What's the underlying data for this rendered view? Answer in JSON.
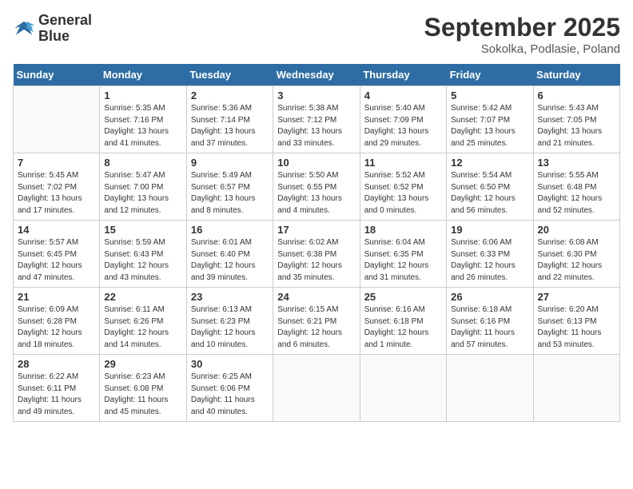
{
  "logo": {
    "line1": "General",
    "line2": "Blue"
  },
  "title": "September 2025",
  "location": "Sokolka, Podlasie, Poland",
  "days_of_week": [
    "Sunday",
    "Monday",
    "Tuesday",
    "Wednesday",
    "Thursday",
    "Friday",
    "Saturday"
  ],
  "weeks": [
    [
      {
        "day": "",
        "info": ""
      },
      {
        "day": "1",
        "info": "Sunrise: 5:35 AM\nSunset: 7:16 PM\nDaylight: 13 hours\nand 41 minutes."
      },
      {
        "day": "2",
        "info": "Sunrise: 5:36 AM\nSunset: 7:14 PM\nDaylight: 13 hours\nand 37 minutes."
      },
      {
        "day": "3",
        "info": "Sunrise: 5:38 AM\nSunset: 7:12 PM\nDaylight: 13 hours\nand 33 minutes."
      },
      {
        "day": "4",
        "info": "Sunrise: 5:40 AM\nSunset: 7:09 PM\nDaylight: 13 hours\nand 29 minutes."
      },
      {
        "day": "5",
        "info": "Sunrise: 5:42 AM\nSunset: 7:07 PM\nDaylight: 13 hours\nand 25 minutes."
      },
      {
        "day": "6",
        "info": "Sunrise: 5:43 AM\nSunset: 7:05 PM\nDaylight: 13 hours\nand 21 minutes."
      }
    ],
    [
      {
        "day": "7",
        "info": "Sunrise: 5:45 AM\nSunset: 7:02 PM\nDaylight: 13 hours\nand 17 minutes."
      },
      {
        "day": "8",
        "info": "Sunrise: 5:47 AM\nSunset: 7:00 PM\nDaylight: 13 hours\nand 12 minutes."
      },
      {
        "day": "9",
        "info": "Sunrise: 5:49 AM\nSunset: 6:57 PM\nDaylight: 13 hours\nand 8 minutes."
      },
      {
        "day": "10",
        "info": "Sunrise: 5:50 AM\nSunset: 6:55 PM\nDaylight: 13 hours\nand 4 minutes."
      },
      {
        "day": "11",
        "info": "Sunrise: 5:52 AM\nSunset: 6:52 PM\nDaylight: 13 hours\nand 0 minutes."
      },
      {
        "day": "12",
        "info": "Sunrise: 5:54 AM\nSunset: 6:50 PM\nDaylight: 12 hours\nand 56 minutes."
      },
      {
        "day": "13",
        "info": "Sunrise: 5:55 AM\nSunset: 6:48 PM\nDaylight: 12 hours\nand 52 minutes."
      }
    ],
    [
      {
        "day": "14",
        "info": "Sunrise: 5:57 AM\nSunset: 6:45 PM\nDaylight: 12 hours\nand 47 minutes."
      },
      {
        "day": "15",
        "info": "Sunrise: 5:59 AM\nSunset: 6:43 PM\nDaylight: 12 hours\nand 43 minutes."
      },
      {
        "day": "16",
        "info": "Sunrise: 6:01 AM\nSunset: 6:40 PM\nDaylight: 12 hours\nand 39 minutes."
      },
      {
        "day": "17",
        "info": "Sunrise: 6:02 AM\nSunset: 6:38 PM\nDaylight: 12 hours\nand 35 minutes."
      },
      {
        "day": "18",
        "info": "Sunrise: 6:04 AM\nSunset: 6:35 PM\nDaylight: 12 hours\nand 31 minutes."
      },
      {
        "day": "19",
        "info": "Sunrise: 6:06 AM\nSunset: 6:33 PM\nDaylight: 12 hours\nand 26 minutes."
      },
      {
        "day": "20",
        "info": "Sunrise: 6:08 AM\nSunset: 6:30 PM\nDaylight: 12 hours\nand 22 minutes."
      }
    ],
    [
      {
        "day": "21",
        "info": "Sunrise: 6:09 AM\nSunset: 6:28 PM\nDaylight: 12 hours\nand 18 minutes."
      },
      {
        "day": "22",
        "info": "Sunrise: 6:11 AM\nSunset: 6:26 PM\nDaylight: 12 hours\nand 14 minutes."
      },
      {
        "day": "23",
        "info": "Sunrise: 6:13 AM\nSunset: 6:23 PM\nDaylight: 12 hours\nand 10 minutes."
      },
      {
        "day": "24",
        "info": "Sunrise: 6:15 AM\nSunset: 6:21 PM\nDaylight: 12 hours\nand 6 minutes."
      },
      {
        "day": "25",
        "info": "Sunrise: 6:16 AM\nSunset: 6:18 PM\nDaylight: 12 hours\nand 1 minute."
      },
      {
        "day": "26",
        "info": "Sunrise: 6:18 AM\nSunset: 6:16 PM\nDaylight: 11 hours\nand 57 minutes."
      },
      {
        "day": "27",
        "info": "Sunrise: 6:20 AM\nSunset: 6:13 PM\nDaylight: 11 hours\nand 53 minutes."
      }
    ],
    [
      {
        "day": "28",
        "info": "Sunrise: 6:22 AM\nSunset: 6:11 PM\nDaylight: 11 hours\nand 49 minutes."
      },
      {
        "day": "29",
        "info": "Sunrise: 6:23 AM\nSunset: 6:08 PM\nDaylight: 11 hours\nand 45 minutes."
      },
      {
        "day": "30",
        "info": "Sunrise: 6:25 AM\nSunset: 6:06 PM\nDaylight: 11 hours\nand 40 minutes."
      },
      {
        "day": "",
        "info": ""
      },
      {
        "day": "",
        "info": ""
      },
      {
        "day": "",
        "info": ""
      },
      {
        "day": "",
        "info": ""
      }
    ]
  ]
}
